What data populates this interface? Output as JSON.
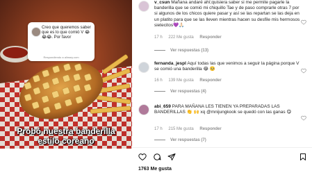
{
  "media": {
    "bubble_question": "Creo que queremos saber que es lo que comió V 😂😂😂. Por favor",
    "bubble_source": "Respondiendo a alinsey.com",
    "caption_line1": "Probó nuestra banderilla",
    "caption_line2": "estilo coreano"
  },
  "comments": [
    {
      "username": "v_csun",
      "text": "Mañana andaré ahí;quisiera saber si me permite pagarle la banderilla que se comió mi chiquillo Tae y de paso comprarle otras 7 por si algunos de los chicos quiere pasar y así se las repartan se las deja en un platito para que se las lleven mientras hacen su desfile mis hermosos sietecitos💜🙏🏻",
      "time": "17 h",
      "likes": "222 Me gusta",
      "reply": "Responder",
      "view_replies": "Ver respuestas (13)"
    },
    {
      "username": "fernanda_jespl",
      "text": "Aquí todas las que venimos a seguir la página porque V se comió una banderilla 😂 🥺",
      "time": "16 h",
      "likes": "139 Me gusta",
      "reply": "Responder",
      "view_replies": "Ver respuestas (4)"
    },
    {
      "username": "abi_659",
      "text": "PARA MAÑANA LES TIENEN YA PREPARADAS LAS BANDERILLAS 👏 🙌 xq @mnijungkook se quedó con las ganas 😋",
      "time": "17 h",
      "likes": "215 Me gusta",
      "reply": "Responder",
      "view_replies": "Ver respuestas (7)"
    }
  ],
  "footer": {
    "likes": "1763 Me gusta"
  },
  "icons": {
    "like": "heart-icon",
    "comment": "comment-icon",
    "share": "share-icon",
    "save": "bookmark-icon"
  },
  "colors": {
    "accent_purple": "#9b59d0",
    "muted_text": "#8e8e8e"
  }
}
